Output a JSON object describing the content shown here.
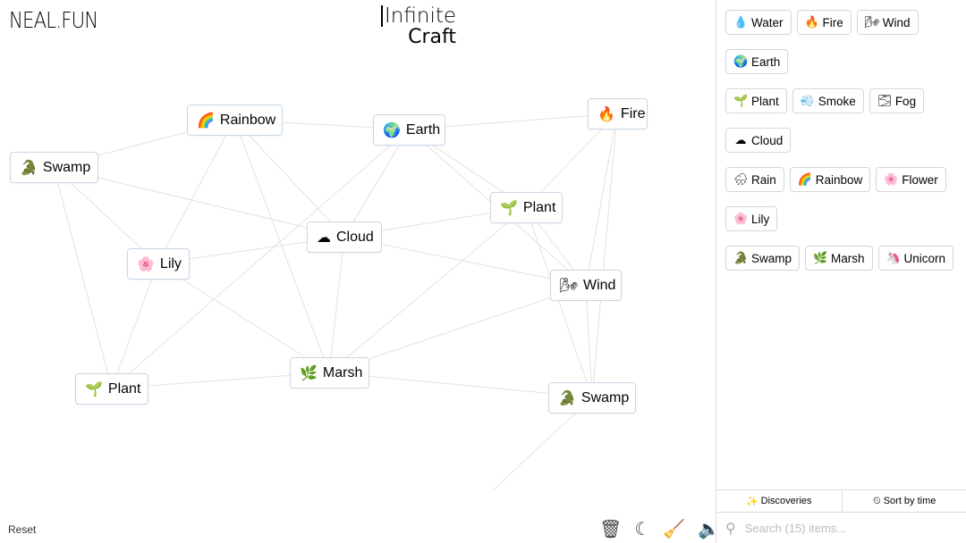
{
  "header": {
    "logo": "NEAL.FUN",
    "title_line1": "Infinite",
    "title_line2": "Craft"
  },
  "canvas_items": [
    {
      "label": "Rainbow",
      "icon": "🌈"
    },
    {
      "label": "Earth",
      "icon": "🌍"
    },
    {
      "label": "Fire",
      "icon": "🔥"
    },
    {
      "label": "Swamp",
      "icon": "🐊"
    },
    {
      "label": "Plant",
      "icon": "🌱"
    },
    {
      "label": "Cloud",
      "icon": "☁"
    },
    {
      "label": "Lily",
      "icon": "🌸"
    },
    {
      "label": "Wind",
      "icon": "🌬"
    },
    {
      "label": "Marsh",
      "icon": "🌿"
    },
    {
      "label": "Plant",
      "icon": "🌱"
    },
    {
      "label": "Swamp",
      "icon": "🐊"
    }
  ],
  "footer": {
    "reset": "Reset",
    "tools": [
      "trash-icon",
      "moon-icon",
      "broom-icon",
      "sound-icon"
    ]
  },
  "sidebar": {
    "items": [
      {
        "label": "Water",
        "icon": "💧"
      },
      {
        "label": "Fire",
        "icon": "🔥"
      },
      {
        "label": "Wind",
        "icon": "🌬"
      },
      {
        "label": "Earth",
        "icon": "🌍"
      },
      {
        "label": "Plant",
        "icon": "🌱"
      },
      {
        "label": "Smoke",
        "icon": "💨"
      },
      {
        "label": "Fog",
        "icon": "🌫"
      },
      {
        "label": "Cloud",
        "icon": "☁"
      },
      {
        "label": "Rain",
        "icon": "🌧"
      },
      {
        "label": "Rainbow",
        "icon": "🌈"
      },
      {
        "label": "Flower",
        "icon": "🌸"
      },
      {
        "label": "Lily",
        "icon": "🌸"
      },
      {
        "label": "Swamp",
        "icon": "🐊"
      },
      {
        "label": "Marsh",
        "icon": "🌿"
      },
      {
        "label": "Unicorn",
        "icon": "🦄"
      }
    ],
    "tabs": {
      "discoveries": "Discoveries",
      "sort": "Sort by time"
    },
    "search_placeholder": "Search (15) items..."
  }
}
